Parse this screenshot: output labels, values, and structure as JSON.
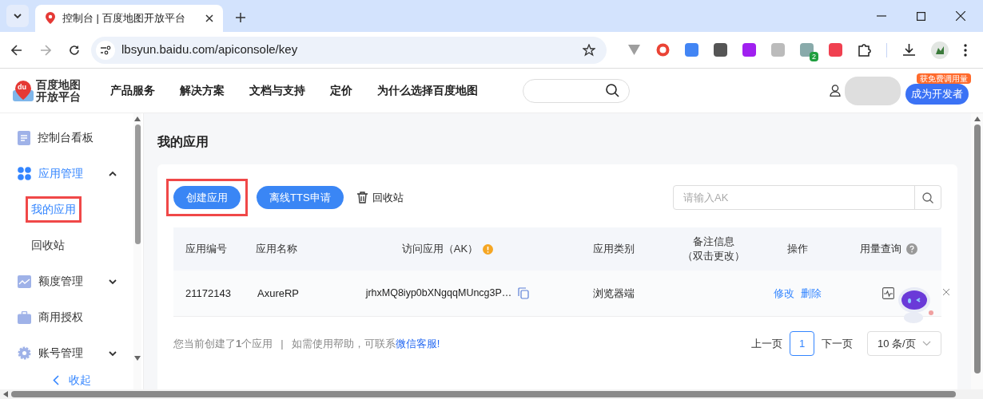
{
  "browser": {
    "tab_title": "控制台 | 百度地图开放平台",
    "url": "lbsyun.baidu.com/apiconsole/key",
    "extension_badge": "2"
  },
  "header": {
    "logo_mark": "du",
    "logo_lines": [
      "百度地图",
      "开放平台"
    ],
    "nav": [
      "产品服务",
      "解决方案",
      "文档与支持",
      "定价",
      "为什么选择百度地图"
    ],
    "promo_badge": "获免费调用量",
    "cta_button": "成为开发者"
  },
  "sidebar": {
    "items": [
      {
        "kind": "dashboard",
        "label": "控制台看板",
        "active": false
      },
      {
        "kind": "apps",
        "label": "应用管理",
        "active": true,
        "expanded": true,
        "children": [
          {
            "label": "我的应用",
            "selected": true,
            "highlighted": true
          },
          {
            "label": "回收站",
            "selected": false,
            "highlighted": false
          }
        ]
      },
      {
        "kind": "quota",
        "label": "额度管理",
        "active": false,
        "expanded": false
      },
      {
        "kind": "license",
        "label": "商用授权",
        "active": false
      },
      {
        "kind": "account",
        "label": "账号管理",
        "active": false,
        "expanded": false
      }
    ],
    "collapse": "收起"
  },
  "content": {
    "title": "我的应用",
    "buttons": [
      {
        "label": "创建应用",
        "highlighted": true
      },
      {
        "label": "离线TTS申请",
        "highlighted": false
      }
    ],
    "recycle": "回收站",
    "search": {
      "placeholder": "请输入AK"
    },
    "table": {
      "columns": [
        [
          "应用编号"
        ],
        [
          "应用名称"
        ],
        [
          "访问应用（AK）"
        ],
        [
          "应用类别"
        ],
        [
          "备注信息",
          "（双击更改）"
        ],
        [
          "操作"
        ],
        [
          "用量查询"
        ]
      ],
      "rows": [
        {
          "id": "21172143",
          "name": "AxureRP",
          "ak": "jrhxMQ8iyp0bXNgqqMUncg3P…",
          "category": "浏览器端",
          "actions": [
            "修改",
            "删除"
          ]
        }
      ]
    },
    "footer": {
      "text": "您当前创建了**1**个应用",
      "separator": "|",
      "help": "如需使用帮助，可联系",
      "link": "微信客服!"
    },
    "pagination": {
      "prev": "上一页",
      "pages": [
        {
          "label": "1",
          "selected": true
        }
      ],
      "next": "下一页",
      "page_size": "10 条/页"
    }
  }
}
